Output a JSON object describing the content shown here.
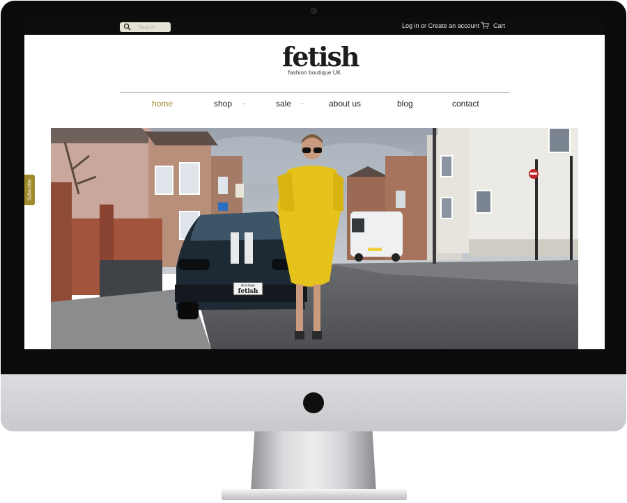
{
  "topbar": {
    "search_placeholder": "Search",
    "login_label": "Log in",
    "or_text": "or",
    "create_account_label": "Create an account",
    "cart_label": "Cart"
  },
  "brand": {
    "name": "fetish",
    "tagline": "fashion boutique UK"
  },
  "nav": {
    "items": [
      {
        "label": "home",
        "active": true
      },
      {
        "label": "shop",
        "has_dropdown": true
      },
      {
        "label": "sale",
        "has_dropdown": true
      },
      {
        "label": "about us"
      },
      {
        "label": "blog"
      },
      {
        "label": "contact"
      }
    ]
  },
  "hero": {
    "plate_top": "MUSTANG",
    "plate_text": "fetish"
  },
  "subscribe": {
    "label": "Subscribe"
  },
  "colors": {
    "accent": "#a08a2c",
    "topbar": "#0d0d0d",
    "dress": "#e6c21c"
  }
}
